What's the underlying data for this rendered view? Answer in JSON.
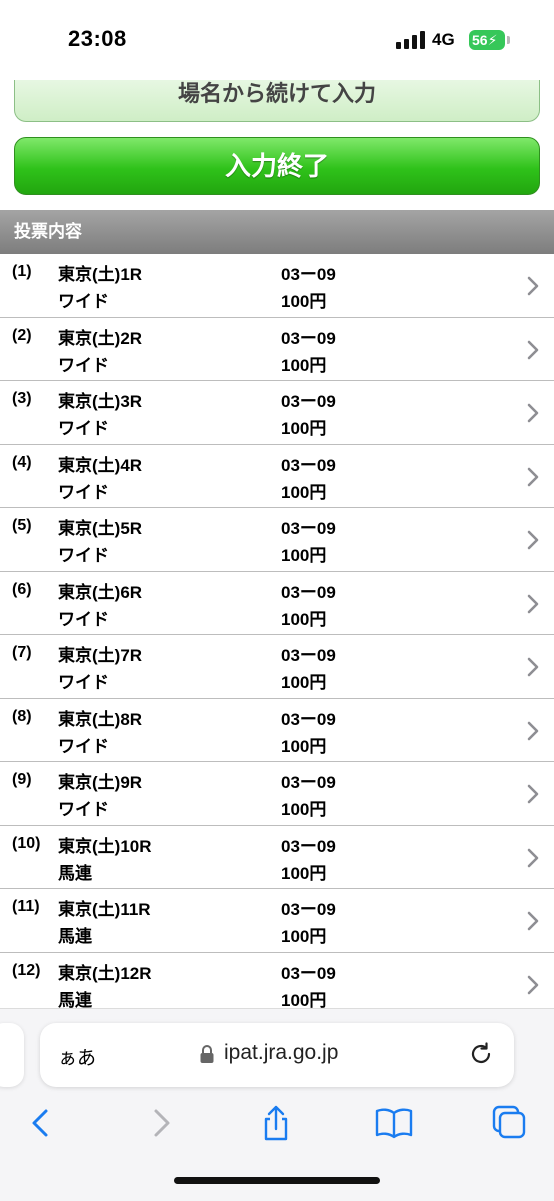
{
  "status_bar": {
    "time": "23:08",
    "network": "4G",
    "battery": "56"
  },
  "buttons": {
    "continue_label": "場名から続けて入力",
    "end_label": "入力終了"
  },
  "section_header": "投票内容",
  "bets": [
    {
      "index": "(1)",
      "race": "東京(土)1R",
      "type": "ワイド",
      "combo": "03ー09",
      "amount": "100円"
    },
    {
      "index": "(2)",
      "race": "東京(土)2R",
      "type": "ワイド",
      "combo": "03ー09",
      "amount": "100円"
    },
    {
      "index": "(3)",
      "race": "東京(土)3R",
      "type": "ワイド",
      "combo": "03ー09",
      "amount": "100円"
    },
    {
      "index": "(4)",
      "race": "東京(土)4R",
      "type": "ワイド",
      "combo": "03ー09",
      "amount": "100円"
    },
    {
      "index": "(5)",
      "race": "東京(土)5R",
      "type": "ワイド",
      "combo": "03ー09",
      "amount": "100円"
    },
    {
      "index": "(6)",
      "race": "東京(土)6R",
      "type": "ワイド",
      "combo": "03ー09",
      "amount": "100円"
    },
    {
      "index": "(7)",
      "race": "東京(土)7R",
      "type": "ワイド",
      "combo": "03ー09",
      "amount": "100円"
    },
    {
      "index": "(8)",
      "race": "東京(土)8R",
      "type": "ワイド",
      "combo": "03ー09",
      "amount": "100円"
    },
    {
      "index": "(9)",
      "race": "東京(土)9R",
      "type": "ワイド",
      "combo": "03ー09",
      "amount": "100円"
    },
    {
      "index": "(10)",
      "race": "東京(土)10R",
      "type": "馬連",
      "combo": "03ー09",
      "amount": "100円"
    },
    {
      "index": "(11)",
      "race": "東京(土)11R",
      "type": "馬連",
      "combo": "03ー09",
      "amount": "100円"
    },
    {
      "index": "(12)",
      "race": "東京(土)12R",
      "type": "馬連",
      "combo": "03ー09",
      "amount": "100円"
    }
  ],
  "browser": {
    "aa_label": "ぁあ",
    "url": "ipat.jra.go.jp",
    "icons": [
      "back-icon",
      "forward-icon",
      "share-icon",
      "bookmarks-icon",
      "tabs-icon"
    ]
  },
  "colors": {
    "accent": "#1a7cf0",
    "end_button": "#2fc21a",
    "header": "#8c8c8c"
  }
}
